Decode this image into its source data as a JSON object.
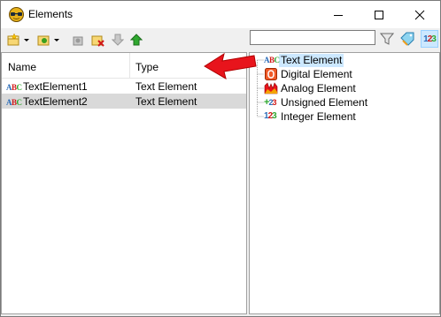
{
  "window": {
    "title": "Elements"
  },
  "search": {
    "value": "",
    "placeholder": ""
  },
  "table": {
    "columns": [
      "Name",
      "Type"
    ],
    "rows": [
      {
        "name": "TextElement1",
        "type": "Text Element",
        "icon": "text-element-icon",
        "selected": false
      },
      {
        "name": "TextElement2",
        "type": "Text Element",
        "icon": "text-element-icon",
        "selected": true
      }
    ]
  },
  "tree": {
    "items": [
      {
        "label": "Text Element",
        "icon": "text-element-icon",
        "selected": true
      },
      {
        "label": "Digital Element",
        "icon": "digital-element-icon",
        "selected": false
      },
      {
        "label": "Analog Element",
        "icon": "analog-element-icon",
        "selected": false
      },
      {
        "label": "Unsigned Element",
        "icon": "unsigned-element-icon",
        "selected": false
      },
      {
        "label": "Integer Element",
        "icon": "integer-element-icon",
        "selected": false
      }
    ]
  },
  "colors": {
    "accent": "#e8141c",
    "selection": "#cce8ff",
    "row_selection": "#d9d9d9"
  }
}
